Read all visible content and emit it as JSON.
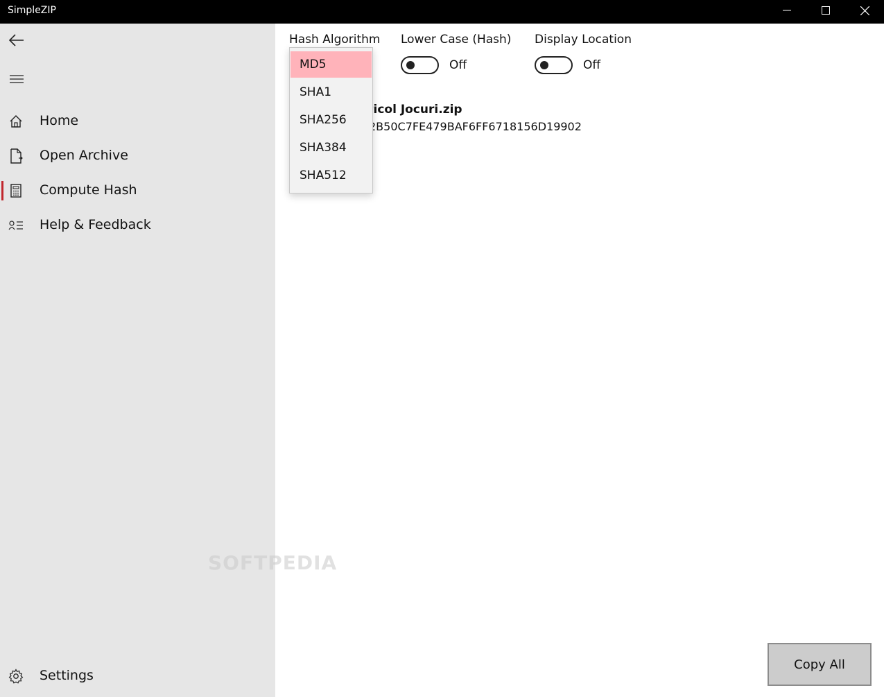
{
  "window": {
    "title": "SimpleZIP"
  },
  "nav": {
    "items": [
      {
        "label": "Home",
        "icon": "home-icon"
      },
      {
        "label": "Open Archive",
        "icon": "open-file-icon"
      },
      {
        "label": "Compute Hash",
        "icon": "calculator-icon",
        "active": true
      },
      {
        "label": "Help & Feedback",
        "icon": "feedback-icon"
      }
    ],
    "settings_label": "Settings"
  },
  "controls": {
    "hash_algorithm_label": "Hash Algorithm",
    "lower_case_label": "Lower Case (Hash)",
    "lower_case_state": "Off",
    "display_location_label": "Display Location",
    "display_location_state": "Off"
  },
  "dropdown": {
    "options": [
      "MD5",
      "SHA1",
      "SHA256",
      "SHA384",
      "SHA512"
    ],
    "selected": "MD5"
  },
  "result": {
    "file_name": "rticol Jocuri.zip",
    "hash": "2B50C7FE479BAF6FF6718156D19902"
  },
  "actions": {
    "copy_all_label": "Copy All"
  },
  "watermark": "SOFTPEDIA",
  "colors": {
    "titlebar": "#000000",
    "sidebar": "#e6e6e6",
    "accent": "#c1272d",
    "selected_option": "#ffb3ba"
  }
}
